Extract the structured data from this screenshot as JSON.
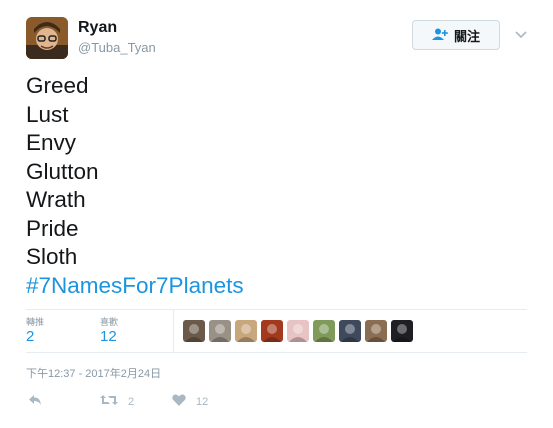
{
  "user": {
    "name": "Ryan",
    "handle": "@Tuba_Tyan"
  },
  "follow_button": {
    "label": "關注"
  },
  "tweet": {
    "lines": [
      "Greed",
      "Lust",
      "Envy",
      "Glutton",
      "Wrath",
      "Pride",
      "Sloth"
    ],
    "hashtag": "#7NamesFor7Planets"
  },
  "stats": {
    "retweets_label": "轉推",
    "retweets_value": "2",
    "likes_label": "喜歡",
    "likes_value": "12"
  },
  "likers": [
    {
      "icon": "liker-avatar-1",
      "color": "#6b5a4a"
    },
    {
      "icon": "liker-avatar-2",
      "color": "#9a9186"
    },
    {
      "icon": "liker-avatar-3",
      "color": "#c9a77c"
    },
    {
      "icon": "liker-avatar-4",
      "color": "#a33a1f"
    },
    {
      "icon": "liker-avatar-5",
      "color": "#e8c3c3"
    },
    {
      "icon": "liker-avatar-6",
      "color": "#7f9a5a"
    },
    {
      "icon": "liker-avatar-7",
      "color": "#3e4a5c"
    },
    {
      "icon": "liker-avatar-8",
      "color": "#8a6d52"
    },
    {
      "icon": "liker-avatar-9",
      "color": "#1e1e24"
    }
  ],
  "timestamp": "下午12:37 - 2017年2月24日",
  "actions": {
    "reply_icon": "reply-icon",
    "retweet_icon": "retweet-icon",
    "retweet_count": "2",
    "like_icon": "heart-icon",
    "like_count": "12"
  },
  "colors": {
    "accent": "#1b95e0",
    "muted": "#8899a6",
    "text": "#14171a"
  }
}
